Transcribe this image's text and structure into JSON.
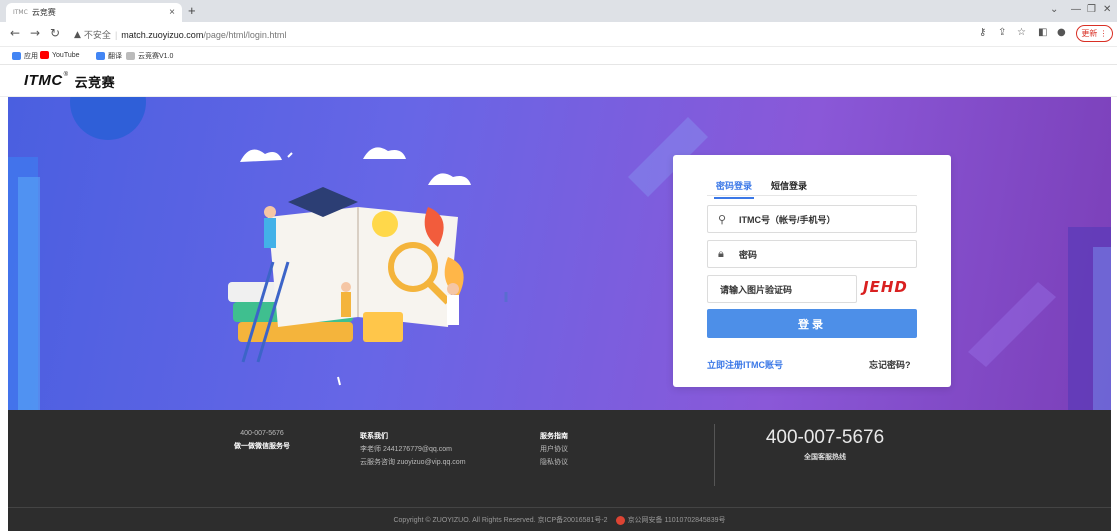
{
  "browser": {
    "tab_title": "云竞赛",
    "tab_favicon_text": "ITMC",
    "url_insecure_label": "不安全",
    "url_host": "match.zuoyizuo.com",
    "url_path": "/page/html/login.html",
    "update_label": "更新",
    "bookmarks": [
      {
        "label": "应用",
        "icon": "apps-grid-icon",
        "color": "#4285f4"
      },
      {
        "label": "YouTube",
        "icon": "youtube-icon",
        "color": "#ff0000"
      },
      {
        "label": "翻译",
        "icon": "translate-icon",
        "color": "#4285f4"
      },
      {
        "label": "云竞赛V1.0",
        "icon": "itmc-favicon-icon",
        "color": "#888888"
      }
    ]
  },
  "site": {
    "logo_text": "ITMC",
    "logo_reg": "®",
    "logo_cn": "云竞赛"
  },
  "login": {
    "tab_password": "密码登录",
    "tab_sms": "短信登录",
    "account_placeholder": "ITMC号（帐号/手机号）",
    "password_placeholder": "密码",
    "captcha_placeholder": "请输入图片验证码",
    "captcha_text": "JEHD",
    "login_button": "登录",
    "register_link": "立即注册ITMC账号",
    "forgot_link": "忘记密码?"
  },
  "footer": {
    "wechat_phone": "400-007-5676",
    "wechat_label": "做一做微信服务号",
    "contact_title": "联系我们",
    "contact_teacher": "李老师 2441276779@qq.com",
    "contact_email": "云服务咨询 zuoyizuo@vip.qq.com",
    "service_title": "服务指南",
    "service_user": "用户协议",
    "service_privacy": "隐私协议",
    "hotline_number": "400-007-5676",
    "hotline_label": "全国客服热线",
    "copyright": "Copyright © ZUOYIZUO. All Rights Reserved. 京ICP备20016581号-2",
    "police_record": "京公网安备 11010702845839号"
  },
  "colors": {
    "accent": "#3b78e7",
    "button": "#4d8fe8",
    "captcha": "#d92020",
    "footer_bg": "#2d2d2d"
  }
}
